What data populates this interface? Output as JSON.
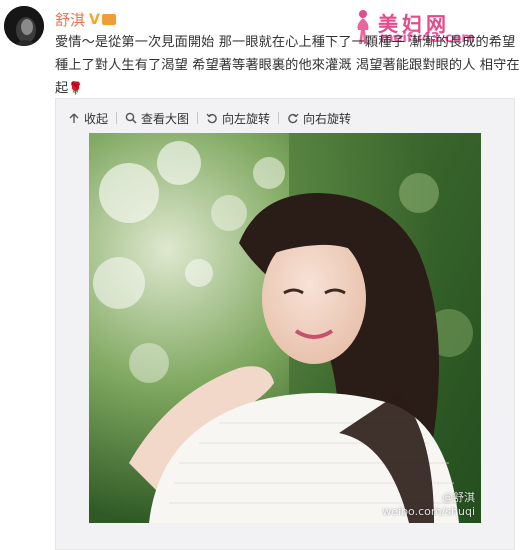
{
  "post": {
    "username": "舒淇",
    "verified_badge": "V",
    "text_lines": [
      "愛情～是從第一次見面開始 那一眼就在心上種下了一顆種子 漸漸的長成的希望 ～",
      "種上了對人生有了渴望 希望著等著眼裏的他來灌溉 渴望著能跟對眼的人 相守在一",
      "起"
    ],
    "rose_emoji": "🌹"
  },
  "watermark_logo": {
    "title": "美妇网",
    "url": "meifu43.com"
  },
  "toolbar": {
    "collapse_label": "收起",
    "view_large_label": "查看大图",
    "rotate_left_label": "向左旋转",
    "rotate_right_label": "向右旋转"
  },
  "photo": {
    "watermark_name": "@舒淇",
    "watermark_url": "weibo.com/shuqi"
  },
  "colors": {
    "username": "#eb7350",
    "badge": "#f5a623",
    "media_bg": "#f2f2f5"
  }
}
